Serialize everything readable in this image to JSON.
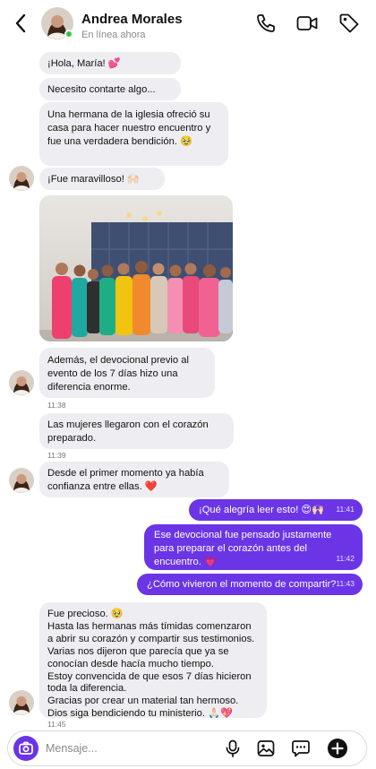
{
  "header": {
    "contact_name": "Andrea Morales",
    "status": "En línea ahora",
    "icons": [
      "back-arrow-icon",
      "phone-icon",
      "video-camera-icon",
      "tag-icon"
    ]
  },
  "colors": {
    "accent": "#6b35e6",
    "incoming_bubble": "#eeeef2",
    "online": "#31c24d"
  },
  "messages": [
    {
      "from": "contact",
      "text": "¡Hola, María! 💕"
    },
    {
      "from": "contact",
      "text": "Necesito contarte algo..."
    },
    {
      "from": "contact",
      "text": "Una hermana de la iglesia ofreció su casa para hacer nuestro encuentro y fue una verdadera bendición. 🥹"
    },
    {
      "from": "contact",
      "text": "¡Fue maravilloso! 🙌🏻"
    },
    {
      "from": "contact",
      "type": "photo"
    },
    {
      "from": "contact",
      "text": "Además, el devocional previo al evento de los 7 días hizo una diferencia enorme.",
      "time": "11:38"
    },
    {
      "from": "contact",
      "text": "Las mujeres llegaron con el corazón preparado.",
      "time": "11:39"
    },
    {
      "from": "contact",
      "text": "Desde el primer momento ya había confianza entre ellas. ❤️"
    },
    {
      "from": "me",
      "text": "¡Qué alegría leer esto! 😍🙌🏻",
      "time": "11:41"
    },
    {
      "from": "me",
      "text": "Ese devocional fue pensado justamente para preparar el corazón antes del encuentro. 💗",
      "time": "11:42"
    },
    {
      "from": "me",
      "text": "¿Cómo vivieron el momento de compartir?",
      "time": "11:43"
    },
    {
      "from": "contact",
      "lines": [
        "Fue precioso. 🥹",
        "Hasta las hermanas más tímidas comenzaron a abrir su corazón y compartir sus testimonios.",
        "Varias nos dijeron que parecía que ya se conocían desde hacía mucho tiempo.",
        "Estoy convencida de que esos 7 días hicieron toda la diferencia.",
        "Gracias por crear un material tan hermoso.",
        "Dios siga bendiciendo tu ministerio. 🙏🏻💖"
      ],
      "time": "11:45"
    }
  ],
  "composer": {
    "placeholder": "Mensaje...",
    "icons": [
      "camera-icon",
      "microphone-icon",
      "image-icon",
      "sticker-icon",
      "add-icon"
    ]
  }
}
